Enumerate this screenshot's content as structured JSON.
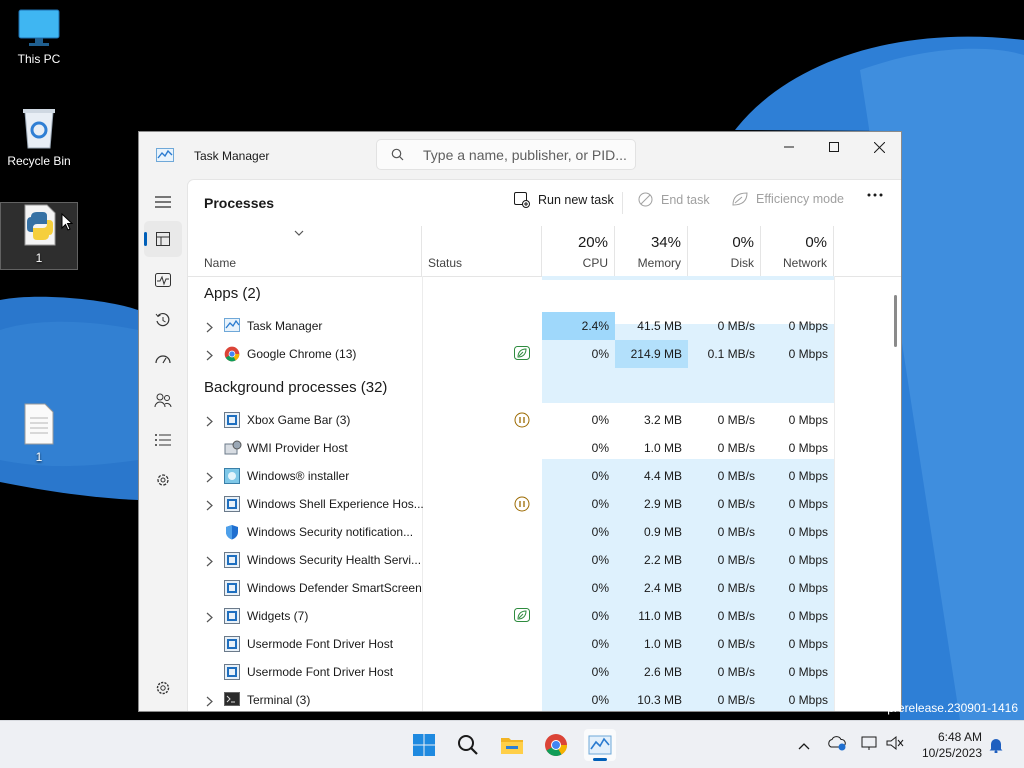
{
  "desktop": {
    "icons": [
      {
        "label": "This PC"
      },
      {
        "label": "Recycle Bin"
      },
      {
        "label": "1"
      },
      {
        "label": "1"
      }
    ],
    "watermark": "prerelease.230901-1416"
  },
  "window": {
    "title": "Task Manager",
    "search_placeholder": "Type a name, publisher, or PID...",
    "page_title": "Processes",
    "commands": {
      "run_new_task": "Run new task",
      "end_task": "End task",
      "efficiency_mode": "Efficiency mode"
    },
    "columns": {
      "name": "Name",
      "status": "Status",
      "cpu": {
        "pct": "20%",
        "label": "CPU"
      },
      "memory": {
        "pct": "34%",
        "label": "Memory"
      },
      "disk": {
        "pct": "0%",
        "label": "Disk"
      },
      "network": {
        "pct": "0%",
        "label": "Network"
      }
    },
    "groups": {
      "apps": "Apps (2)",
      "background": "Background processes (32)"
    },
    "apps": [
      {
        "name": "Task Manager",
        "cpu": "2.4%",
        "memory": "41.5 MB",
        "disk": "0 MB/s",
        "network": "0 Mbps",
        "expandable": true,
        "icon": "task-manager-icon",
        "status": ""
      },
      {
        "name": "Google Chrome (13)",
        "cpu": "0%",
        "memory": "214.9 MB",
        "disk": "0.1 MB/s",
        "network": "0 Mbps",
        "expandable": true,
        "icon": "chrome-icon",
        "status": "efficiency-leaf-icon"
      }
    ],
    "background": [
      {
        "name": "Xbox Game Bar (3)",
        "cpu": "0%",
        "memory": "3.2 MB",
        "disk": "0 MB/s",
        "network": "0 Mbps",
        "expandable": true,
        "icon": "app-window-icon",
        "status": "suspended-pause-icon"
      },
      {
        "name": "WMI Provider Host",
        "cpu": "0%",
        "memory": "1.0 MB",
        "disk": "0 MB/s",
        "network": "0 Mbps",
        "expandable": false,
        "icon": "wmi-host-icon",
        "status": ""
      },
      {
        "name": "Windows® installer",
        "cpu": "0%",
        "memory": "4.4 MB",
        "disk": "0 MB/s",
        "network": "0 Mbps",
        "expandable": true,
        "icon": "installer-icon",
        "status": ""
      },
      {
        "name": "Windows Shell Experience Hos...",
        "cpu": "0%",
        "memory": "2.9 MB",
        "disk": "0 MB/s",
        "network": "0 Mbps",
        "expandable": true,
        "icon": "app-window-icon",
        "status": "suspended-pause-icon"
      },
      {
        "name": "Windows Security notification...",
        "cpu": "0%",
        "memory": "0.9 MB",
        "disk": "0 MB/s",
        "network": "0 Mbps",
        "expandable": false,
        "icon": "security-shield-icon",
        "status": ""
      },
      {
        "name": "Windows Security Health Servi...",
        "cpu": "0%",
        "memory": "2.2 MB",
        "disk": "0 MB/s",
        "network": "0 Mbps",
        "expandable": true,
        "icon": "app-window-icon",
        "status": ""
      },
      {
        "name": "Windows Defender SmartScreen",
        "cpu": "0%",
        "memory": "2.4 MB",
        "disk": "0 MB/s",
        "network": "0 Mbps",
        "expandable": false,
        "icon": "app-window-icon",
        "status": ""
      },
      {
        "name": "Widgets (7)",
        "cpu": "0%",
        "memory": "11.0 MB",
        "disk": "0 MB/s",
        "network": "0 Mbps",
        "expandable": true,
        "icon": "app-window-icon",
        "status": "efficiency-leaf-icon"
      },
      {
        "name": "Usermode Font Driver Host",
        "cpu": "0%",
        "memory": "1.0 MB",
        "disk": "0 MB/s",
        "network": "0 Mbps",
        "expandable": false,
        "icon": "app-window-icon",
        "status": ""
      },
      {
        "name": "Usermode Font Driver Host",
        "cpu": "0%",
        "memory": "2.6 MB",
        "disk": "0 MB/s",
        "network": "0 Mbps",
        "expandable": false,
        "icon": "app-window-icon",
        "status": ""
      },
      {
        "name": "Terminal (3)",
        "cpu": "0%",
        "memory": "10.3 MB",
        "disk": "0 MB/s",
        "network": "0 Mbps",
        "expandable": true,
        "icon": "terminal-icon",
        "status": ""
      }
    ],
    "nav_items": [
      "hamburger-menu-icon",
      "processes-icon",
      "performance-icon",
      "app-history-icon",
      "startup-apps-icon",
      "users-icon",
      "details-icon",
      "services-icon",
      "settings-icon"
    ]
  },
  "taskbar": {
    "time": "6:48 AM",
    "date": "10/25/2023",
    "pinned": [
      "start-icon",
      "search-icon",
      "file-explorer-icon",
      "chrome-icon",
      "task-manager-icon"
    ]
  },
  "colors": {
    "accent": "#005fb8",
    "cpu_heat_high": "#9fd8fb",
    "heat_light": "#def1fd",
    "memory_heat_high": "#b3e0fb"
  }
}
